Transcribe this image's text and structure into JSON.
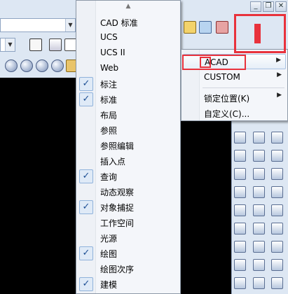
{
  "window": {
    "minimize_glyph": "_",
    "restore_glyph": "❐",
    "close_glyph": "✕"
  },
  "colors": {
    "annotation": "#e8323c",
    "checked_bg": "#dfeaf7",
    "menu_bg": "#f4f6fa",
    "toolbar_bg": "#dde7f3"
  },
  "toolbar_menu": {
    "scroll_up_glyph": "▲",
    "check_glyph": "✓",
    "items": [
      {
        "label": "CAD 标准",
        "checked": false
      },
      {
        "label": "UCS",
        "checked": false
      },
      {
        "label": "UCS II",
        "checked": false
      },
      {
        "label": "Web",
        "checked": false
      },
      {
        "label": "标注",
        "checked": true
      },
      {
        "label": "标准",
        "checked": true
      },
      {
        "label": "布局",
        "checked": false
      },
      {
        "label": "参照",
        "checked": false
      },
      {
        "label": "参照编辑",
        "checked": false
      },
      {
        "label": "插入点",
        "checked": false
      },
      {
        "label": "查询",
        "checked": true
      },
      {
        "label": "动态观察",
        "checked": false
      },
      {
        "label": "对象捕捉",
        "checked": true
      },
      {
        "label": "工作空间",
        "checked": false
      },
      {
        "label": "光源",
        "checked": false
      },
      {
        "label": "绘图",
        "checked": true
      },
      {
        "label": "绘图次序",
        "checked": false
      },
      {
        "label": "建模",
        "checked": true
      }
    ]
  },
  "submenu": {
    "arrow_glyph": "▶",
    "items": [
      {
        "label": "ACAD",
        "has_submenu": true,
        "highlighted": true
      },
      {
        "label": "CUSTOM",
        "has_submenu": true,
        "highlighted": false
      },
      {
        "label": "锁定位置(K)",
        "has_submenu": true,
        "highlighted": false
      },
      {
        "label": "自定义(C)...",
        "has_submenu": false,
        "highlighted": false
      }
    ]
  }
}
